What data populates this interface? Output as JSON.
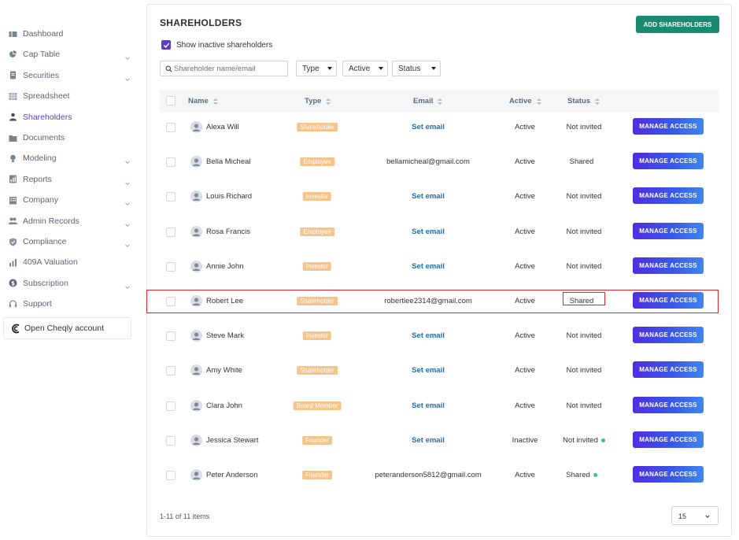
{
  "sidebar": {
    "items": [
      {
        "label": "Dashboard",
        "icon": "dashboard-icon"
      },
      {
        "label": "Cap Table",
        "icon": "pie-chart-icon"
      },
      {
        "label": "Securities",
        "icon": "document-icon"
      },
      {
        "label": "Spreadsheet",
        "icon": "grid-icon"
      },
      {
        "label": "Shareholders",
        "icon": "person-icon"
      },
      {
        "label": "Documents",
        "icon": "folder-icon"
      },
      {
        "label": "Modeling",
        "icon": "lightbulb-icon"
      },
      {
        "label": "Reports",
        "icon": "report-icon"
      },
      {
        "label": "Company",
        "icon": "building-icon"
      },
      {
        "label": "Admin Records",
        "icon": "people-icon"
      },
      {
        "label": "Compliance",
        "icon": "shield-icon"
      },
      {
        "label": "409A Valuation",
        "icon": "bar-chart-icon"
      },
      {
        "label": "Subscription",
        "icon": "dollar-icon"
      },
      {
        "label": "Support",
        "icon": "headset-icon"
      }
    ],
    "active": "Shareholders",
    "open_account": "Open Cheqly account"
  },
  "page": {
    "title": "SHAREHOLDERS",
    "add_button": "ADD SHAREHOLDERS",
    "show_inactive_label": "Show inactive shareholders",
    "show_inactive_checked": true
  },
  "filters": {
    "search_placeholder": "Shareholder name/email",
    "type": "Type",
    "active": "Active",
    "status": "Status"
  },
  "table": {
    "headers": {
      "name": "Name",
      "type": "Type",
      "email": "Email",
      "active": "Active",
      "status": "Status"
    },
    "manage_label": "MANAGE ACCESS",
    "rows": [
      {
        "name": "Alexa Will",
        "type": "Shareholder",
        "email": "Set email",
        "email_is_link": true,
        "active": "Active",
        "status": "Not invited",
        "status_dot": false
      },
      {
        "name": "Bella Micheal",
        "type": "Employee",
        "email": "bellamicheal@gmail.com",
        "email_is_link": false,
        "active": "Active",
        "status": "Shared",
        "status_dot": false
      },
      {
        "name": "Louis Richard",
        "type": "Investor",
        "email": "Set email",
        "email_is_link": true,
        "active": "Active",
        "status": "Not invited",
        "status_dot": false
      },
      {
        "name": "Rosa Francis",
        "type": "Employee",
        "email": "Set email",
        "email_is_link": true,
        "active": "Active",
        "status": "Not invited",
        "status_dot": false
      },
      {
        "name": "Annie John",
        "type": "Investor",
        "email": "Set email",
        "email_is_link": true,
        "active": "Active",
        "status": "Not invited",
        "status_dot": false
      },
      {
        "name": "Robert Lee",
        "type": "Shareholder",
        "email": "robertlee2314@gmail.com",
        "email_is_link": false,
        "active": "Active",
        "status": "Shared",
        "status_dot": false
      },
      {
        "name": "Steve Mark",
        "type": "Investor",
        "email": "Set email",
        "email_is_link": true,
        "active": "Active",
        "status": "Not invited",
        "status_dot": false
      },
      {
        "name": "Amy White",
        "type": "Shareholder",
        "email": "Set email",
        "email_is_link": true,
        "active": "Active",
        "status": "Not invited",
        "status_dot": false
      },
      {
        "name": "Clara John",
        "type": "Board Member",
        "email": "Set email",
        "email_is_link": true,
        "active": "Active",
        "status": "Not invited",
        "status_dot": false
      },
      {
        "name": "Jessica Stewart",
        "type": "Founder",
        "email": "Set email",
        "email_is_link": true,
        "active": "Inactive",
        "status": "Not invited",
        "status_dot": true
      },
      {
        "name": "Peter Anderson",
        "type": "Founder",
        "email": "peteranderson5812@gmail.com",
        "email_is_link": false,
        "active": "Active",
        "status": "Shared",
        "status_dot": true
      }
    ]
  },
  "footer": {
    "count": "1-11 of 11 items",
    "page_size": "15"
  },
  "colors": {
    "brand_purple": "#5b3cc4",
    "add_button_green": "#1a8a72",
    "type_badge": "#f5c48a",
    "link_blue": "#1f6fb0",
    "highlight_red": "#e0242f",
    "status_dot_green": "#3fbf8a"
  }
}
